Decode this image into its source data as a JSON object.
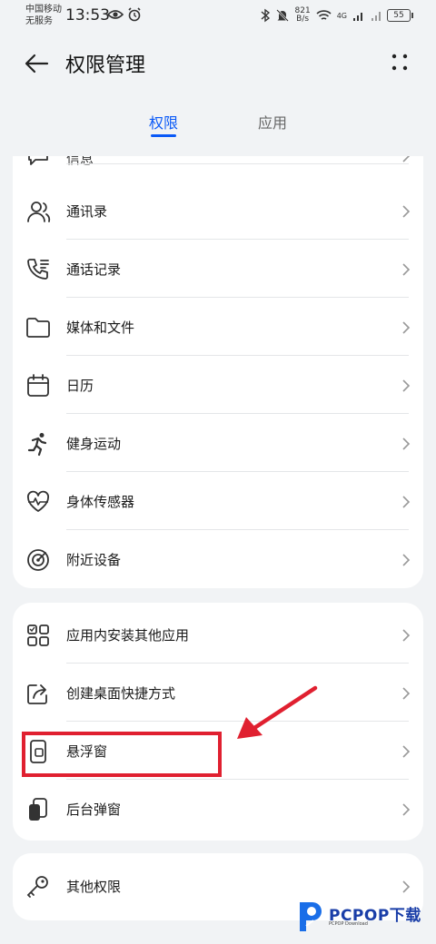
{
  "status_bar": {
    "carrier_line1": "中国移动",
    "carrier_line2": "无服务",
    "time": "13:53",
    "net_speed_value": "821",
    "net_speed_unit": "B/s",
    "network": "4G",
    "battery": "55"
  },
  "header": {
    "title": "权限管理"
  },
  "tabs": [
    {
      "label": "权限",
      "active": true
    },
    {
      "label": "应用",
      "active": false
    }
  ],
  "group1": [
    {
      "label": "信息",
      "icon": "message-icon",
      "partial": true
    },
    {
      "label": "通讯录",
      "icon": "contacts-icon"
    },
    {
      "label": "通话记录",
      "icon": "call-log-icon"
    },
    {
      "label": "媒体和文件",
      "icon": "folder-icon"
    },
    {
      "label": "日历",
      "icon": "calendar-icon"
    },
    {
      "label": "健身运动",
      "icon": "running-icon"
    },
    {
      "label": "身体传感器",
      "icon": "heart-rate-icon"
    },
    {
      "label": "附近设备",
      "icon": "radar-icon"
    }
  ],
  "group2": [
    {
      "label": "应用内安装其他应用",
      "icon": "apps-grid-icon"
    },
    {
      "label": "创建桌面快捷方式",
      "icon": "shortcut-icon"
    },
    {
      "label": "悬浮窗",
      "icon": "floating-window-icon",
      "highlighted": true
    },
    {
      "label": "后台弹窗",
      "icon": "background-popup-icon"
    }
  ],
  "group3": [
    {
      "label": "其他权限",
      "icon": "key-icon"
    }
  ],
  "watermark": {
    "text": "PCPOP下载",
    "subtext": "PCPOP Download"
  },
  "colors": {
    "accent": "#0a59f7",
    "annotation": "#e02030",
    "background": "#f1f3f5"
  }
}
